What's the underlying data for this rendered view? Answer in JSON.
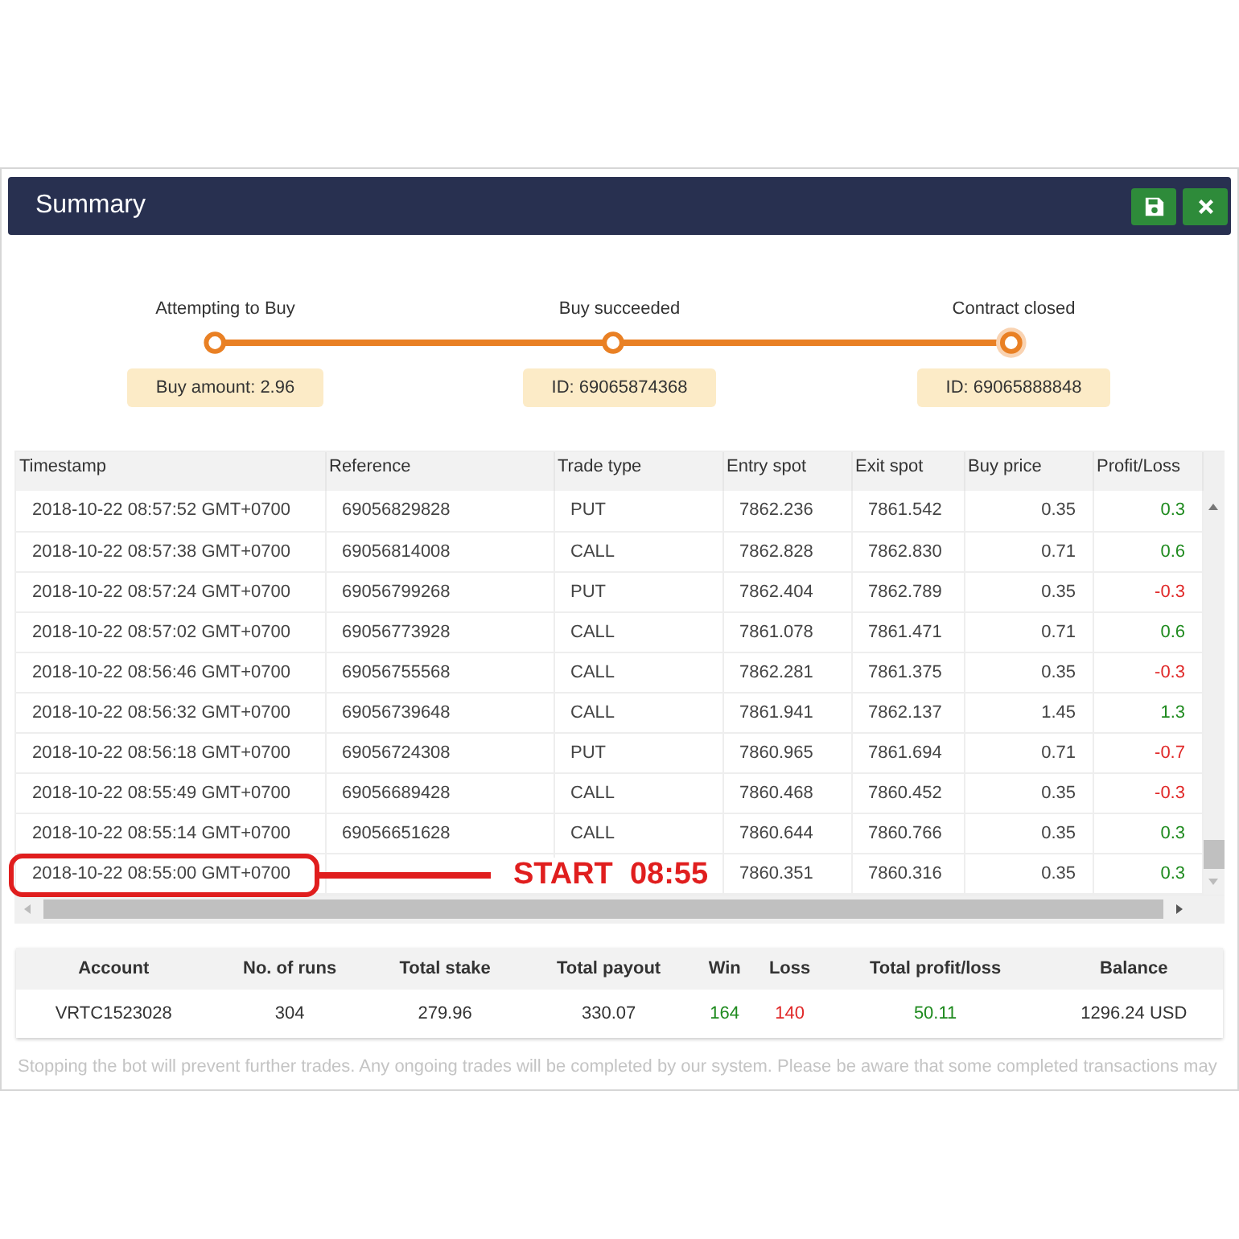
{
  "dialog": {
    "title": "Summary",
    "buttons": [
      {
        "kind": "save"
      },
      {
        "kind": "close"
      }
    ]
  },
  "steps": [
    {
      "label": "Attempting to Buy",
      "note": "Buy amount: 2.96",
      "current": false
    },
    {
      "label": "Buy succeeded",
      "note": "ID: 69065874368",
      "current": false
    },
    {
      "label": "Contract closed",
      "note": "ID: 69065888848",
      "current": true
    }
  ],
  "trades": {
    "columns": [
      "Timestamp",
      "Reference",
      "Trade type",
      "Entry spot",
      "Exit spot",
      "Buy price",
      "Profit/Loss"
    ],
    "rows": [
      {
        "cells": [
          "2018-10-22 08:57:52 GMT+0700",
          "69056829828",
          "PUT",
          "7862.236",
          "7861.542",
          "0.35",
          "0.3"
        ],
        "color": "#1e8a1e"
      },
      {
        "cells": [
          "2018-10-22 08:57:38 GMT+0700",
          "69056814008",
          "CALL",
          "7862.828",
          "7862.830",
          "0.71",
          "0.6"
        ],
        "color": "#1e8a1e"
      },
      {
        "cells": [
          "2018-10-22 08:57:24 GMT+0700",
          "69056799268",
          "PUT",
          "7862.404",
          "7862.789",
          "0.35",
          "-0.3"
        ],
        "color": "#e02828"
      },
      {
        "cells": [
          "2018-10-22 08:57:02 GMT+0700",
          "69056773928",
          "CALL",
          "7861.078",
          "7861.471",
          "0.71",
          "0.6"
        ],
        "color": "#1e8a1e"
      },
      {
        "cells": [
          "2018-10-22 08:56:46 GMT+0700",
          "69056755568",
          "CALL",
          "7862.281",
          "7861.375",
          "0.35",
          "-0.3"
        ],
        "color": "#e02828"
      },
      {
        "cells": [
          "2018-10-22 08:56:32 GMT+0700",
          "69056739648",
          "CALL",
          "7861.941",
          "7862.137",
          "1.45",
          "1.3"
        ],
        "color": "#1e8a1e"
      },
      {
        "cells": [
          "2018-10-22 08:56:18 GMT+0700",
          "69056724308",
          "PUT",
          "7860.965",
          "7861.694",
          "0.71",
          "-0.7"
        ],
        "color": "#e02828"
      },
      {
        "cells": [
          "2018-10-22 08:55:49 GMT+0700",
          "69056689428",
          "CALL",
          "7860.468",
          "7860.452",
          "0.35",
          "-0.3"
        ],
        "color": "#e02828"
      },
      {
        "cells": [
          "2018-10-22 08:55:14 GMT+0700",
          "69056651628",
          "CALL",
          "7860.644",
          "7860.766",
          "0.35",
          "0.3"
        ],
        "color": "#1e8a1e"
      },
      {
        "cells": [
          "2018-10-22 08:55:00 GMT+0700",
          "",
          "",
          "7860.351",
          "7860.316",
          "0.35",
          "0.3"
        ],
        "color": "#1e8a1e"
      }
    ]
  },
  "annotation": {
    "text": "START  08:55"
  },
  "totals": {
    "columns": [
      "Account",
      "No. of runs",
      "Total stake",
      "Total payout",
      "Win",
      "Loss",
      "Total profit/loss",
      "Balance"
    ],
    "cells": [
      {
        "text": "VRTC1523028"
      },
      {
        "text": "304"
      },
      {
        "text": "279.96"
      },
      {
        "text": "330.07"
      },
      {
        "text": "164",
        "color": "#1e8a1e"
      },
      {
        "text": "140",
        "color": "#e02828"
      },
      {
        "text": "50.11",
        "color": "#1e8a1e"
      },
      {
        "text": "1296.24 USD"
      }
    ]
  },
  "footer_note": "Stopping the bot will prevent further trades. Any ongoing trades will be completed by our system. Please be aware that some completed transactions may"
}
